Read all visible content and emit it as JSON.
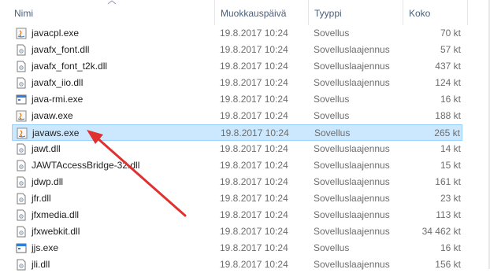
{
  "columns": {
    "name": "Nimi",
    "date": "Muokkauspäivä",
    "type": "Tyyppi",
    "size": "Koko"
  },
  "colors": {
    "header_text": "#4c607a",
    "selection_bg": "#cce8ff",
    "selection_border": "#99d1ff",
    "arrow": "#e03030"
  },
  "files": [
    {
      "name": "javacpl.exe",
      "date": "19.8.2017 10:24",
      "type": "Sovellus",
      "size": "70 kt",
      "icon": "java-app-icon"
    },
    {
      "name": "javafx_font.dll",
      "date": "19.8.2017 10:24",
      "type": "Sovelluslaajennus",
      "size": "57 kt",
      "icon": "dll-icon"
    },
    {
      "name": "javafx_font_t2k.dll",
      "date": "19.8.2017 10:24",
      "type": "Sovelluslaajennus",
      "size": "437 kt",
      "icon": "dll-icon"
    },
    {
      "name": "javafx_iio.dll",
      "date": "19.8.2017 10:24",
      "type": "Sovelluslaajennus",
      "size": "124 kt",
      "icon": "dll-icon"
    },
    {
      "name": "java-rmi.exe",
      "date": "19.8.2017 10:24",
      "type": "Sovellus",
      "size": "16 kt",
      "icon": "exe-window-icon"
    },
    {
      "name": "javaw.exe",
      "date": "19.8.2017 10:24",
      "type": "Sovellus",
      "size": "188 kt",
      "icon": "java-app-icon"
    },
    {
      "name": "javaws.exe",
      "date": "19.8.2017 10:24",
      "type": "Sovellus",
      "size": "265 kt",
      "icon": "java-app-icon",
      "selected": true
    },
    {
      "name": "jawt.dll",
      "date": "19.8.2017 10:24",
      "type": "Sovelluslaajennus",
      "size": "14 kt",
      "icon": "dll-icon"
    },
    {
      "name": "JAWTAccessBridge-32.dll",
      "date": "19.8.2017 10:24",
      "type": "Sovelluslaajennus",
      "size": "15 kt",
      "icon": "dll-icon"
    },
    {
      "name": "jdwp.dll",
      "date": "19.8.2017 10:24",
      "type": "Sovelluslaajennus",
      "size": "161 kt",
      "icon": "dll-icon"
    },
    {
      "name": "jfr.dll",
      "date": "19.8.2017 10:24",
      "type": "Sovelluslaajennus",
      "size": "23 kt",
      "icon": "dll-icon"
    },
    {
      "name": "jfxmedia.dll",
      "date": "19.8.2017 10:24",
      "type": "Sovelluslaajennus",
      "size": "113 kt",
      "icon": "dll-icon"
    },
    {
      "name": "jfxwebkit.dll",
      "date": "19.8.2017 10:24",
      "type": "Sovelluslaajennus",
      "size": "34 462 kt",
      "icon": "dll-icon"
    },
    {
      "name": "jjs.exe",
      "date": "19.8.2017 10:24",
      "type": "Sovellus",
      "size": "16 kt",
      "icon": "exe-window-icon"
    },
    {
      "name": "jli.dll",
      "date": "19.8.2017 10:24",
      "type": "Sovelluslaajennus",
      "size": "156 kt",
      "icon": "dll-icon"
    }
  ]
}
